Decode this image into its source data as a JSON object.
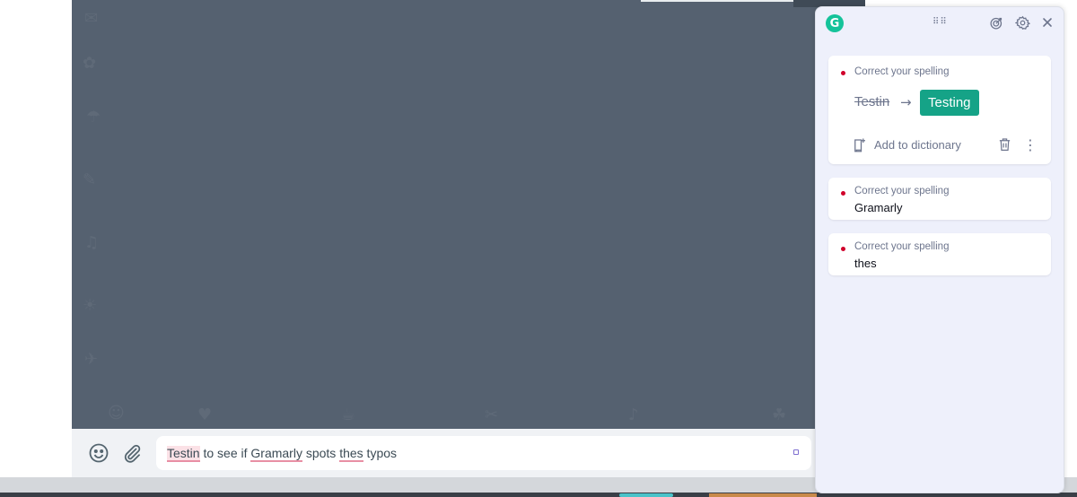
{
  "composer": {
    "message_text": {
      "word1": "Testin",
      "part1": " to see if ",
      "word2": "Gramarly",
      "part2": " spots ",
      "word3": "thes",
      "part3": " typos"
    },
    "emoji_icon": "smiley-icon",
    "attach_icon": "paperclip-icon"
  },
  "grammarly": {
    "logo_letter": "G",
    "brand_color": "#15c39a",
    "suggestion_color": "#15a387",
    "error_dot_color": "#d0002a",
    "cards": [
      {
        "category": "Correct your spelling",
        "original": "Testin",
        "arrow": "→",
        "replacement": "Testing",
        "add_to_dictionary": "Add to dictionary"
      },
      {
        "category": "Correct your spelling",
        "word": "Gramarly"
      },
      {
        "category": "Correct your spelling",
        "word": "thes"
      }
    ]
  }
}
